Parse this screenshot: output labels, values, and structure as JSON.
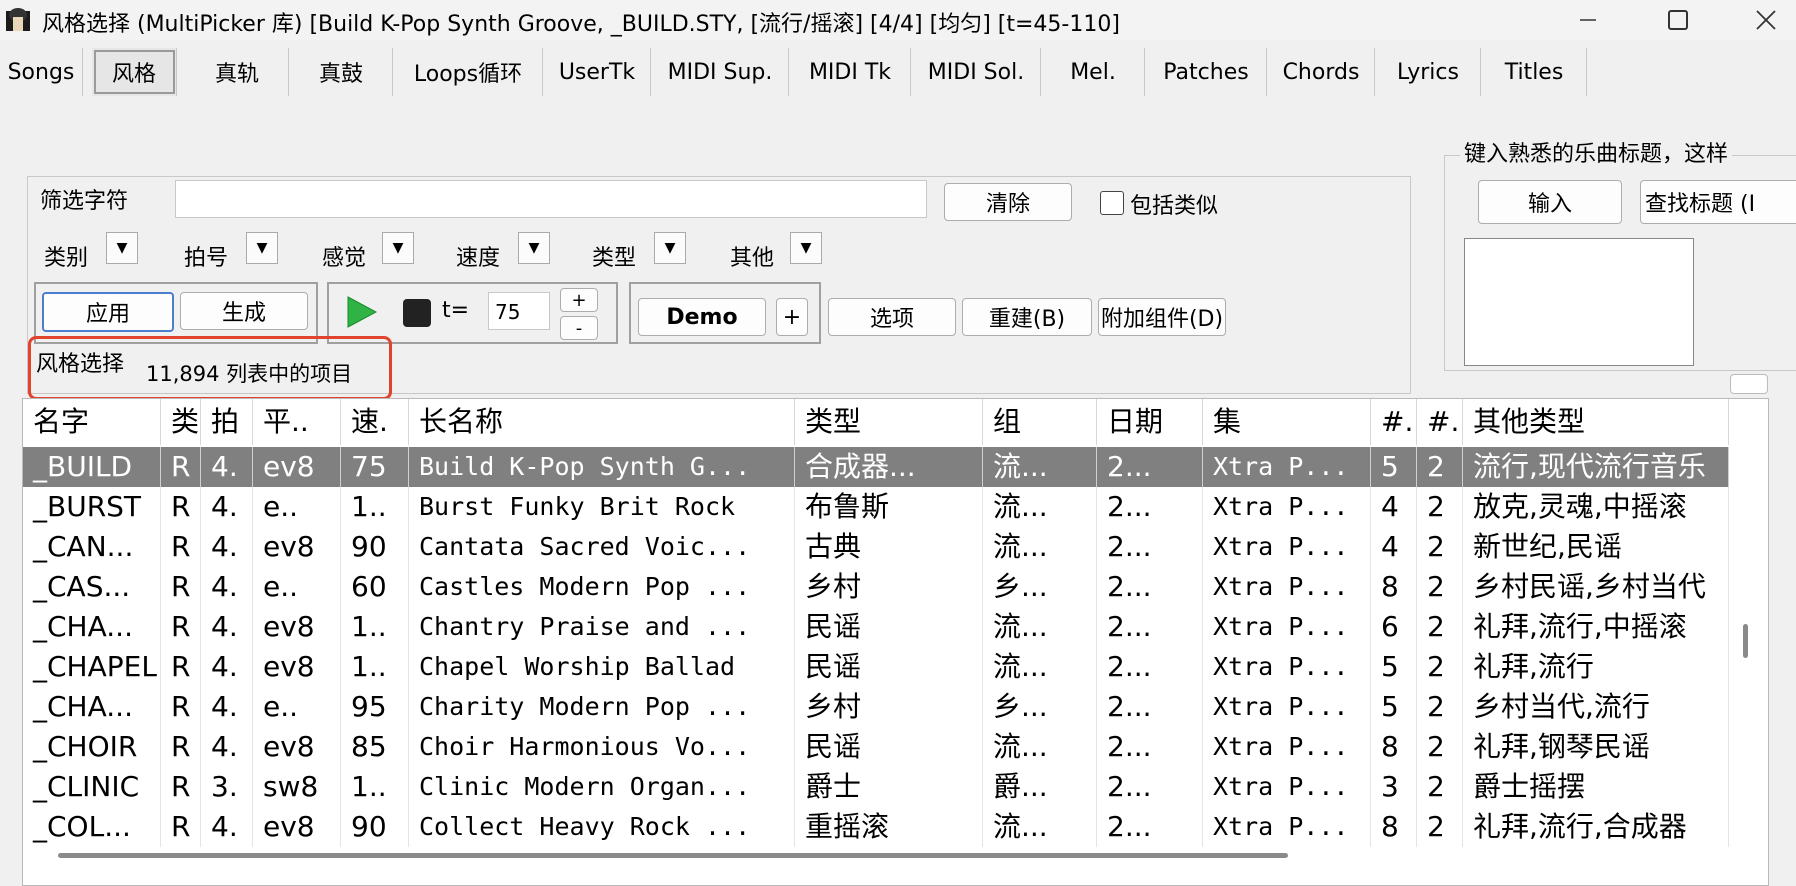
{
  "window": {
    "title": "风格选择  (MultiPicker 库)   [Build K-Pop Synth Groove, _BUILD.STY,  [流行/摇滚] [4/4] [均匀] [t=45-110]"
  },
  "tabs": [
    "Songs",
    "风格",
    "真轨",
    "真鼓",
    "Loops循环",
    "UserTk",
    "MIDI Sup.",
    "MIDI Tk",
    "MIDI Sol.",
    "Mel.",
    "Patches",
    "Chords",
    "Lyrics",
    "Titles"
  ],
  "filter": {
    "label": "筛选字符",
    "value": "",
    "clear_label": "清除",
    "include_similar_label": "包括类似",
    "include_similar_checked": false,
    "dropdowns": [
      "类别",
      "拍号",
      "感觉",
      "速度",
      "类型",
      "其他"
    ]
  },
  "actions": {
    "apply_label": "应用",
    "generate_label": "生成",
    "tempo_prefix": "t=",
    "tempo_value": "75",
    "plus": "+",
    "minus": "-",
    "demo_label": "Demo",
    "demo_plus": "+",
    "options_label": "选项",
    "rebuild_label": "重建(B)",
    "addons_label": "附加组件(D)"
  },
  "status": {
    "label": "风格选择",
    "count_text": "11,894 列表中的项目"
  },
  "right_panel": {
    "hint": "键入熟悉的乐曲标题，这样",
    "input_label": "输入",
    "find_title_label": "查找标题 (I"
  },
  "table": {
    "columns": [
      "名字",
      "类",
      "拍",
      "平..",
      "速.",
      "长名称",
      "类型",
      "组",
      "日期",
      "集",
      "#.",
      "#.",
      "其他类型"
    ],
    "selected_row": 0,
    "rows": [
      [
        "_BUILD",
        "R",
        "4.",
        "ev8",
        "75",
        "Build K-Pop Synth G...",
        "合成器...",
        "流...",
        "2...",
        "Xtra P...",
        "5",
        "2",
        "流行,现代流行音乐"
      ],
      [
        "_BURST",
        "R",
        "4.",
        "e..",
        "1..",
        "Burst Funky Brit Rock",
        "布鲁斯",
        "流...",
        "2...",
        "Xtra P...",
        "4",
        "2",
        "放克,灵魂,中摇滚"
      ],
      [
        "_CAN...",
        "R",
        "4.",
        "ev8",
        "90",
        "Cantata Sacred Voic...",
        "古典",
        "流...",
        "2...",
        "Xtra P...",
        "4",
        "2",
        "新世纪,民谣"
      ],
      [
        "_CAS...",
        "R",
        "4.",
        "e..",
        "60",
        "Castles Modern Pop ...",
        "乡村",
        "乡...",
        "2...",
        "Xtra P...",
        "8",
        "2",
        "乡村民谣,乡村当代"
      ],
      [
        "_CHA...",
        "R",
        "4.",
        "ev8",
        "1..",
        "Chantry Praise and ...",
        "民谣",
        "流...",
        "2...",
        "Xtra P...",
        "6",
        "2",
        "礼拜,流行,中摇滚"
      ],
      [
        "_CHAPEL",
        "R",
        "4.",
        "ev8",
        "1..",
        "Chapel Worship Ballad",
        "民谣",
        "流...",
        "2...",
        "Xtra P...",
        "5",
        "2",
        "礼拜,流行"
      ],
      [
        "_CHA...",
        "R",
        "4.",
        "e..",
        "95",
        "Charity Modern Pop ...",
        "乡村",
        "乡...",
        "2...",
        "Xtra P...",
        "5",
        "2",
        "乡村当代,流行"
      ],
      [
        "_CHOIR",
        "R",
        "4.",
        "ev8",
        "85",
        "Choir Harmonious Vo...",
        "民谣",
        "流...",
        "2...",
        "Xtra P...",
        "8",
        "2",
        "礼拜,钢琴民谣"
      ],
      [
        "_CLINIC",
        "R",
        "3.",
        "sw8",
        "1..",
        "Clinic Modern Organ...",
        "爵士",
        "爵...",
        "2...",
        "Xtra P...",
        "3",
        "2",
        "爵士摇摆"
      ],
      [
        "_COL...",
        "R",
        "4.",
        "ev8",
        "90",
        "Collect Heavy Rock ...",
        "重摇滚",
        "流...",
        "2...",
        "Xtra P...",
        "8",
        "2",
        "礼拜,流行,合成器"
      ]
    ]
  },
  "colors": {
    "highlight_border": "#e0442c",
    "play_green": "#2fb344",
    "selected_row_bg": "#808080"
  },
  "icons": [
    "app-icon",
    "minimize-icon",
    "maximize-icon",
    "close-icon",
    "play-icon",
    "stop-icon",
    "chevron-down-icon"
  ]
}
